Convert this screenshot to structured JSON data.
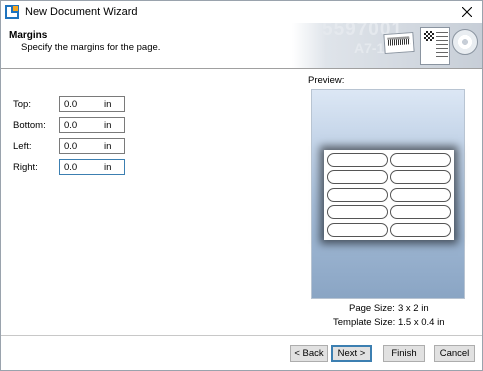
{
  "window": {
    "title": "New Document Wizard"
  },
  "header": {
    "title": "Margins",
    "subtitle": "Specify the margins for the page."
  },
  "header_art": {
    "number1": "5597001",
    "number2": "A7-116"
  },
  "margins": [
    {
      "label": "Top:",
      "value": "0.0",
      "unit": "in"
    },
    {
      "label": "Bottom:",
      "value": "0.0",
      "unit": "in"
    },
    {
      "label": "Left:",
      "value": "0.0",
      "unit": "in"
    },
    {
      "label": "Right:",
      "value": "0.0",
      "unit": "in"
    }
  ],
  "preview": {
    "label": "Preview:",
    "page_size_label": "Page Size:",
    "page_size_value": "3 x 2 in",
    "template_size_label": "Template Size:",
    "template_size_value": "1.5 x 0.4 in",
    "labels_columns": 2,
    "labels_rows": 5
  },
  "buttons": {
    "back": "< Back",
    "next": "Next >",
    "finish": "Finish",
    "cancel": "Cancel"
  },
  "icons": {
    "app": "app-icon",
    "close": "close-icon"
  },
  "colors": {
    "accent": "#3c7fb1",
    "preview_top": "#dce7f5",
    "preview_bottom": "#8aa5c4"
  }
}
